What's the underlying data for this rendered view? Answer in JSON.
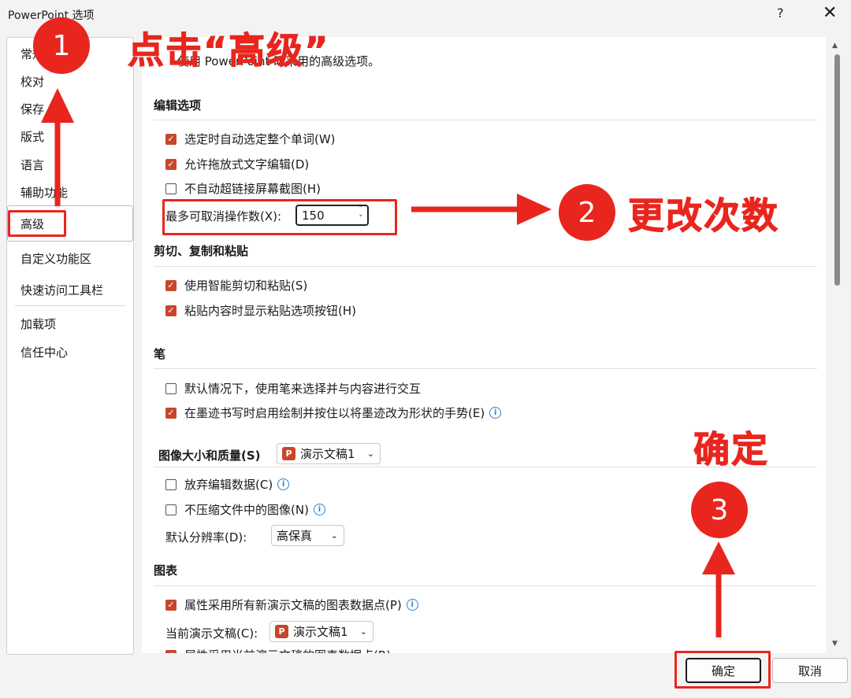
{
  "window": {
    "title": "PowerPoint 选项",
    "help": "?",
    "close": "✕"
  },
  "sidebar": {
    "items": [
      {
        "label": "常规"
      },
      {
        "label": "校对"
      },
      {
        "label": "保存"
      },
      {
        "label": "版式"
      },
      {
        "label": "语言"
      },
      {
        "label": "辅助功能"
      },
      {
        "label": "高级"
      },
      {
        "label": "自定义功能区"
      },
      {
        "label": "快速访问工具栏"
      },
      {
        "label": "加载项"
      },
      {
        "label": "信任中心"
      }
    ]
  },
  "content": {
    "header": "使用 PowerPoint 时采用的高级选项。",
    "editing": {
      "title": "编辑选项",
      "select_word": "选定时自动选定整个单词(W)",
      "drag_drop": "允许拖放式文字编辑(D)",
      "no_hyperlink": "不自动超链接屏幕截图(H)",
      "undo_label": "最多可取消操作数(X):",
      "undo_value": "150"
    },
    "cut_paste": {
      "title": "剪切、复制和粘贴",
      "smart_cut": "使用智能剪切和粘贴(S)",
      "paste_options": "粘贴内容时显示粘贴选项按钮(H)"
    },
    "pen": {
      "title": "笔",
      "default_pen": "默认情况下，使用笔来选择并与内容进行交互",
      "ink_shapes": "在墨迹书写时启用绘制并按住以将墨迹改为形状的手势(E)"
    },
    "image": {
      "title": "图像大小和质量(S)",
      "file": "演示文稿1",
      "discard": "放弃编辑数据(C)",
      "no_compress": "不压缩文件中的图像(N)",
      "resolution_label": "默认分辨率(D):",
      "resolution_value": "高保真"
    },
    "chart": {
      "title": "图表",
      "all_new": "属性采用所有新演示文稿的图表数据点(P)",
      "current_label": "当前演示文稿(C):",
      "current_file": "演示文稿1",
      "current_prop": "属性采用当前演示文稿的图表数据点(R)"
    }
  },
  "buttons": {
    "ok": "确定",
    "cancel": "取消"
  },
  "annotations": {
    "badge1": "1",
    "text1": "点击“高级”",
    "badge2": "2",
    "text2": "更改次数",
    "badge3": "3",
    "text3": "确定"
  },
  "icons": {
    "check": "✓",
    "info": "i",
    "ppt": "P",
    "chevron": "⌄"
  },
  "colors": {
    "accent": "#c8462b",
    "annotation": "#e8261e",
    "info": "#2f7fd1"
  }
}
